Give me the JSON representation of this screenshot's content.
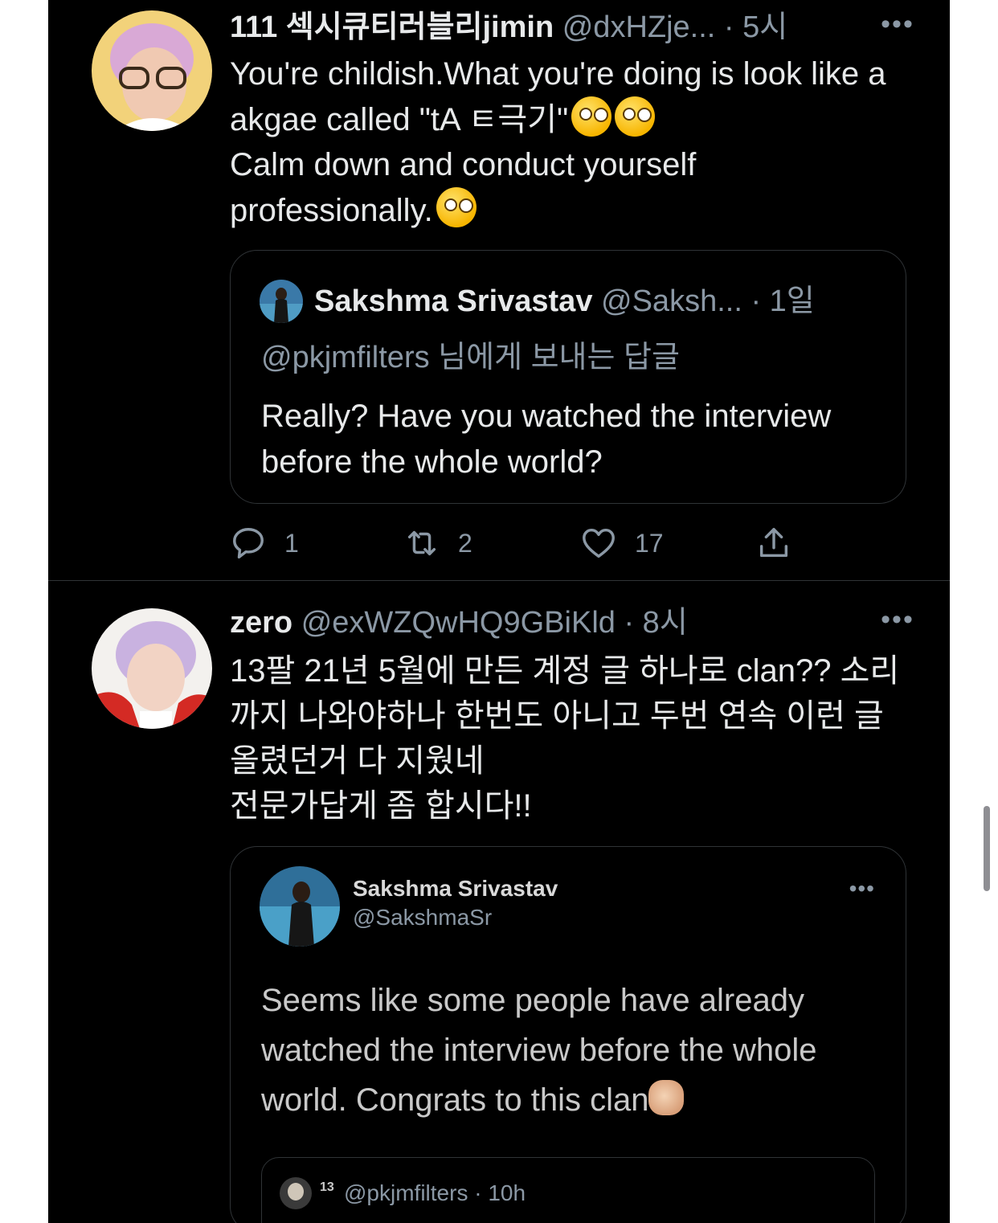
{
  "tweets": [
    {
      "display_name": "111 섹시큐티러블리jimin",
      "handle": "@dxHZje...",
      "time": "· 5시",
      "more": "•••",
      "body": "You're childish.What you're doing is look like a akgae called \"tA ㅌ극기\"",
      "body2": "Calm down and conduct yourself professionally.",
      "quote": {
        "display_name": "Sakshma Srivastav",
        "handle": "@Saksh...",
        "time": "· 1일",
        "reply_to": "@pkjmfilters 님에게 보내는 답글",
        "text": "Really? Have you watched the interview before the whole world?"
      },
      "actions": {
        "reply": "1",
        "retweet": "2",
        "like": "17"
      }
    },
    {
      "display_name": "zero",
      "handle": "@exWZQwHQ9GBiKld",
      "time": "· 8시",
      "more": "•••",
      "body": "13팔 21년 5월에 만든 계정 글 하나로 clan?? 소리까지 나와야하나 한번도 아니고 두번 연속 이런 글 올렸던거 다 지웠네",
      "body2": "전문가답게 좀 합시다!!",
      "embedded": {
        "display_name": "Sakshma Srivastav",
        "handle": "@SakshmaSr",
        "more": "•••",
        "text": "Seems like some people have already watched the interview before the whole world. Congrats to this clan",
        "inner_count": "13",
        "inner_meta": "@pkjmfilters · 10h"
      }
    }
  ],
  "icons": {
    "reply": "reply-bubble-icon",
    "retweet": "retweet-icon",
    "like": "heart-icon",
    "share": "share-icon",
    "emoji_zany": "zany-face-emoji",
    "emoji_wink_tongue": "winking-tongue-emoji",
    "emoji_clap": "clapping-hands-emoji"
  },
  "colors": {
    "background": "#000000",
    "text": "#e7e9ea",
    "secondary": "#8b98a5",
    "border": "#2f3336"
  }
}
